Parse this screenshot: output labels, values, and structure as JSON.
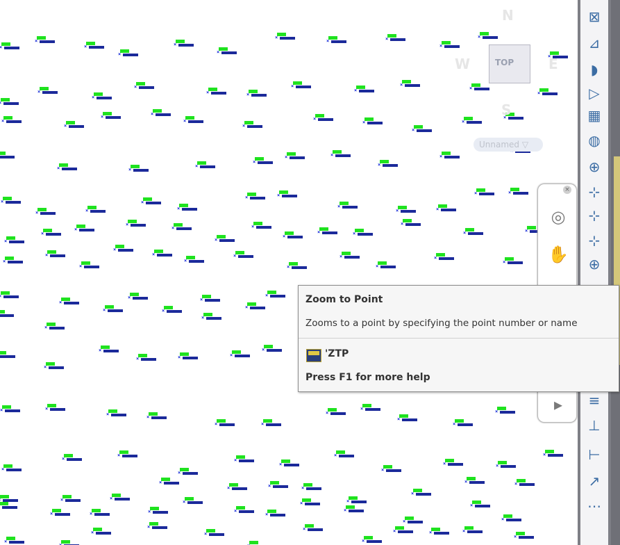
{
  "viewcube": {
    "north": "N",
    "south": "S",
    "east": "E",
    "west": "W",
    "top_face": "TOP",
    "ucs_menu": "Unnamed ▽"
  },
  "tooltip": {
    "title": "Zoom to Point",
    "description": "Zooms to a point by specifying the point number or name",
    "command": "'ZTP",
    "help": "Press F1 for more help"
  },
  "navbar": {
    "close_glyph": "×",
    "steering_wheel_icon": "steering-wheel",
    "pan_icon": "hand",
    "zoom_icon": "magnifier"
  },
  "ribbon": {
    "icons": [
      "line-icon",
      "polyline-icon",
      "arc-icon",
      "angle-icon",
      "table-icon",
      "globe-icon",
      "grid-icon",
      "point-icon",
      "point-number-icon",
      "point-name-icon",
      "zoom-to-point-icon",
      "dimension-icon",
      "dimension-step-icon",
      "dimension-offset-icon",
      "aligned-dim-icon",
      "leader-icon",
      "quick-dim-icon"
    ]
  },
  "colors": {
    "point_label": "#1fe21f",
    "point_marker": "#1a2fd8",
    "ribbon_bg": "#7e7f86"
  }
}
